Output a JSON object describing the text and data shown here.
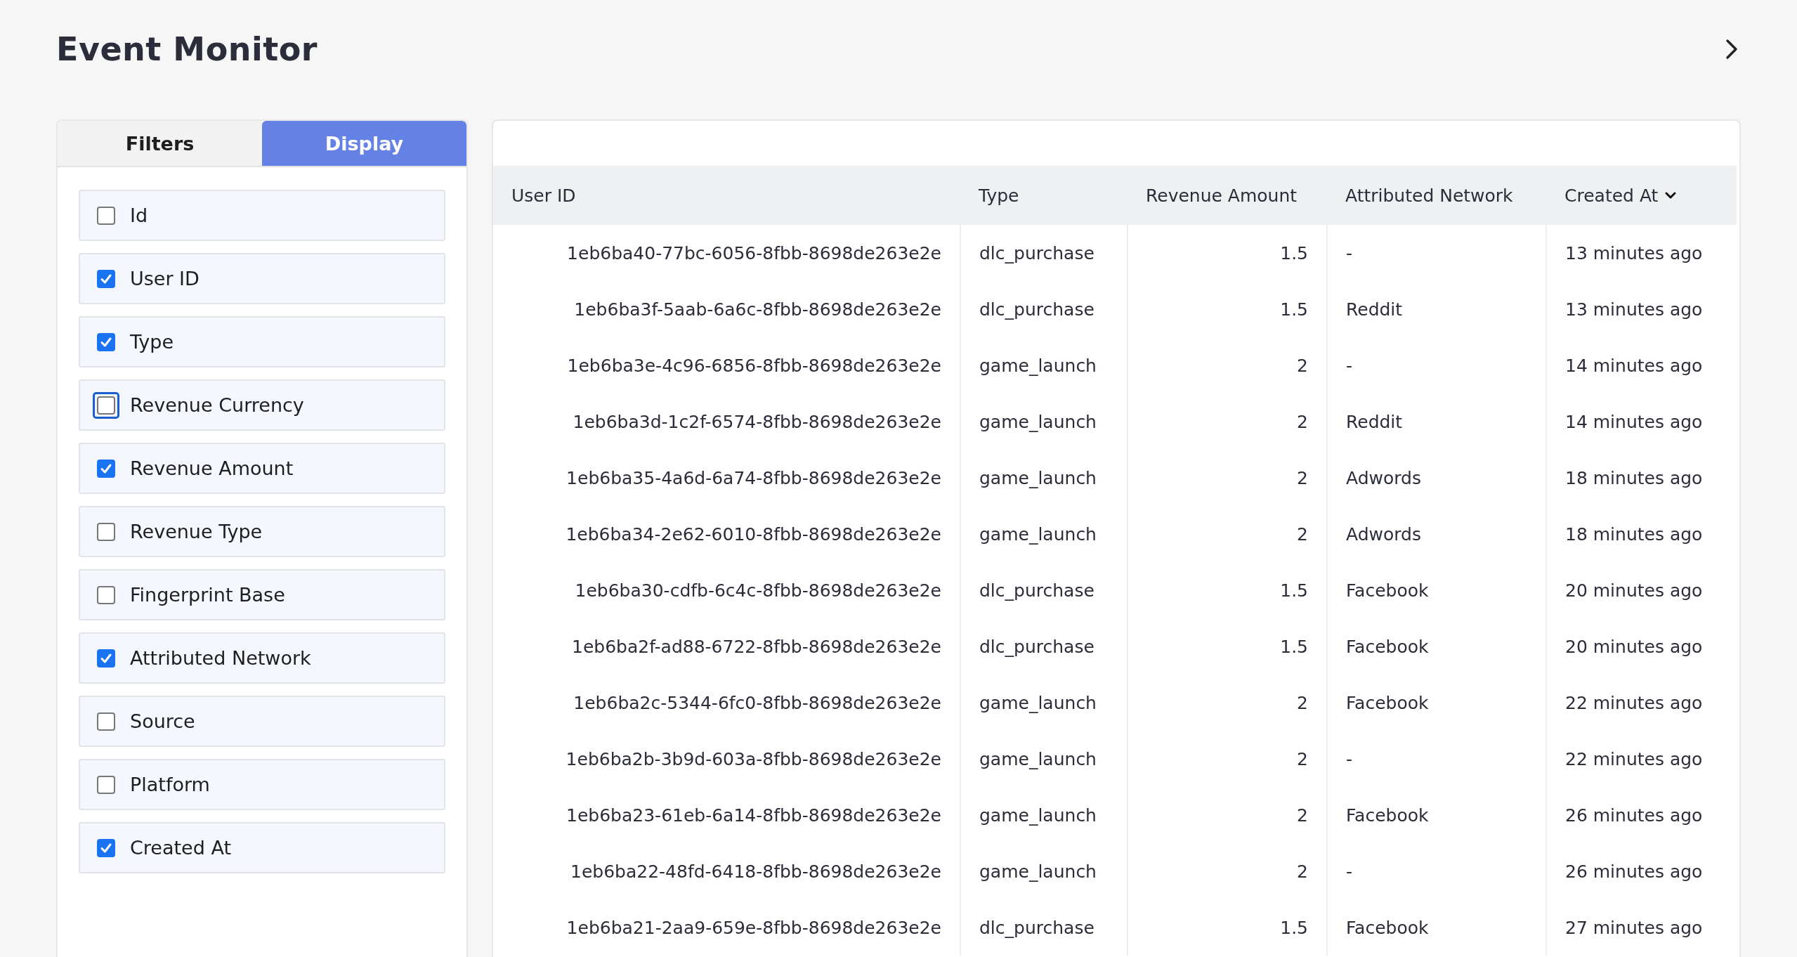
{
  "page": {
    "title": "Event Monitor"
  },
  "tabs": [
    {
      "label": "Filters",
      "selected": false
    },
    {
      "label": "Display",
      "selected": true
    }
  ],
  "display_options": [
    {
      "label": "Id",
      "checked": false,
      "focused": false
    },
    {
      "label": "User ID",
      "checked": true,
      "focused": false
    },
    {
      "label": "Type",
      "checked": true,
      "focused": false
    },
    {
      "label": "Revenue Currency",
      "checked": false,
      "focused": true
    },
    {
      "label": "Revenue Amount",
      "checked": true,
      "focused": false
    },
    {
      "label": "Revenue Type",
      "checked": false,
      "focused": false
    },
    {
      "label": "Fingerprint Base",
      "checked": false,
      "focused": false
    },
    {
      "label": "Attributed Network",
      "checked": true,
      "focused": false
    },
    {
      "label": "Source",
      "checked": false,
      "focused": false
    },
    {
      "label": "Platform",
      "checked": false,
      "focused": false
    },
    {
      "label": "Created At",
      "checked": true,
      "focused": false
    }
  ],
  "table": {
    "columns": [
      {
        "label": "User ID",
        "sorted": false
      },
      {
        "label": "Type",
        "sorted": false
      },
      {
        "label": "Revenue Amount",
        "sorted": false
      },
      {
        "label": "Attributed Network",
        "sorted": false
      },
      {
        "label": "Created At",
        "sorted": true
      }
    ],
    "rows": [
      [
        "1eb6ba40-77bc-6056-8fbb-8698de263e2e",
        "dlc_purchase",
        "1.5",
        "-",
        "13 minutes ago"
      ],
      [
        "1eb6ba3f-5aab-6a6c-8fbb-8698de263e2e",
        "dlc_purchase",
        "1.5",
        "Reddit",
        "13 minutes ago"
      ],
      [
        "1eb6ba3e-4c96-6856-8fbb-8698de263e2e",
        "game_launch",
        "2",
        "-",
        "14 minutes ago"
      ],
      [
        "1eb6ba3d-1c2f-6574-8fbb-8698de263e2e",
        "game_launch",
        "2",
        "Reddit",
        "14 minutes ago"
      ],
      [
        "1eb6ba35-4a6d-6a74-8fbb-8698de263e2e",
        "game_launch",
        "2",
        "Adwords",
        "18 minutes ago"
      ],
      [
        "1eb6ba34-2e62-6010-8fbb-8698de263e2e",
        "game_launch",
        "2",
        "Adwords",
        "18 minutes ago"
      ],
      [
        "1eb6ba30-cdfb-6c4c-8fbb-8698de263e2e",
        "dlc_purchase",
        "1.5",
        "Facebook",
        "20 minutes ago"
      ],
      [
        "1eb6ba2f-ad88-6722-8fbb-8698de263e2e",
        "dlc_purchase",
        "1.5",
        "Facebook",
        "20 minutes ago"
      ],
      [
        "1eb6ba2c-5344-6fc0-8fbb-8698de263e2e",
        "game_launch",
        "2",
        "Facebook",
        "22 minutes ago"
      ],
      [
        "1eb6ba2b-3b9d-603a-8fbb-8698de263e2e",
        "game_launch",
        "2",
        "-",
        "22 minutes ago"
      ],
      [
        "1eb6ba23-61eb-6a14-8fbb-8698de263e2e",
        "game_launch",
        "2",
        "Facebook",
        "26 minutes ago"
      ],
      [
        "1eb6ba22-48fd-6418-8fbb-8698de263e2e",
        "game_launch",
        "2",
        "-",
        "26 minutes ago"
      ],
      [
        "1eb6ba21-2aa9-659e-8fbb-8698de263e2e",
        "dlc_purchase",
        "1.5",
        "Facebook",
        "27 minutes ago"
      ]
    ]
  }
}
